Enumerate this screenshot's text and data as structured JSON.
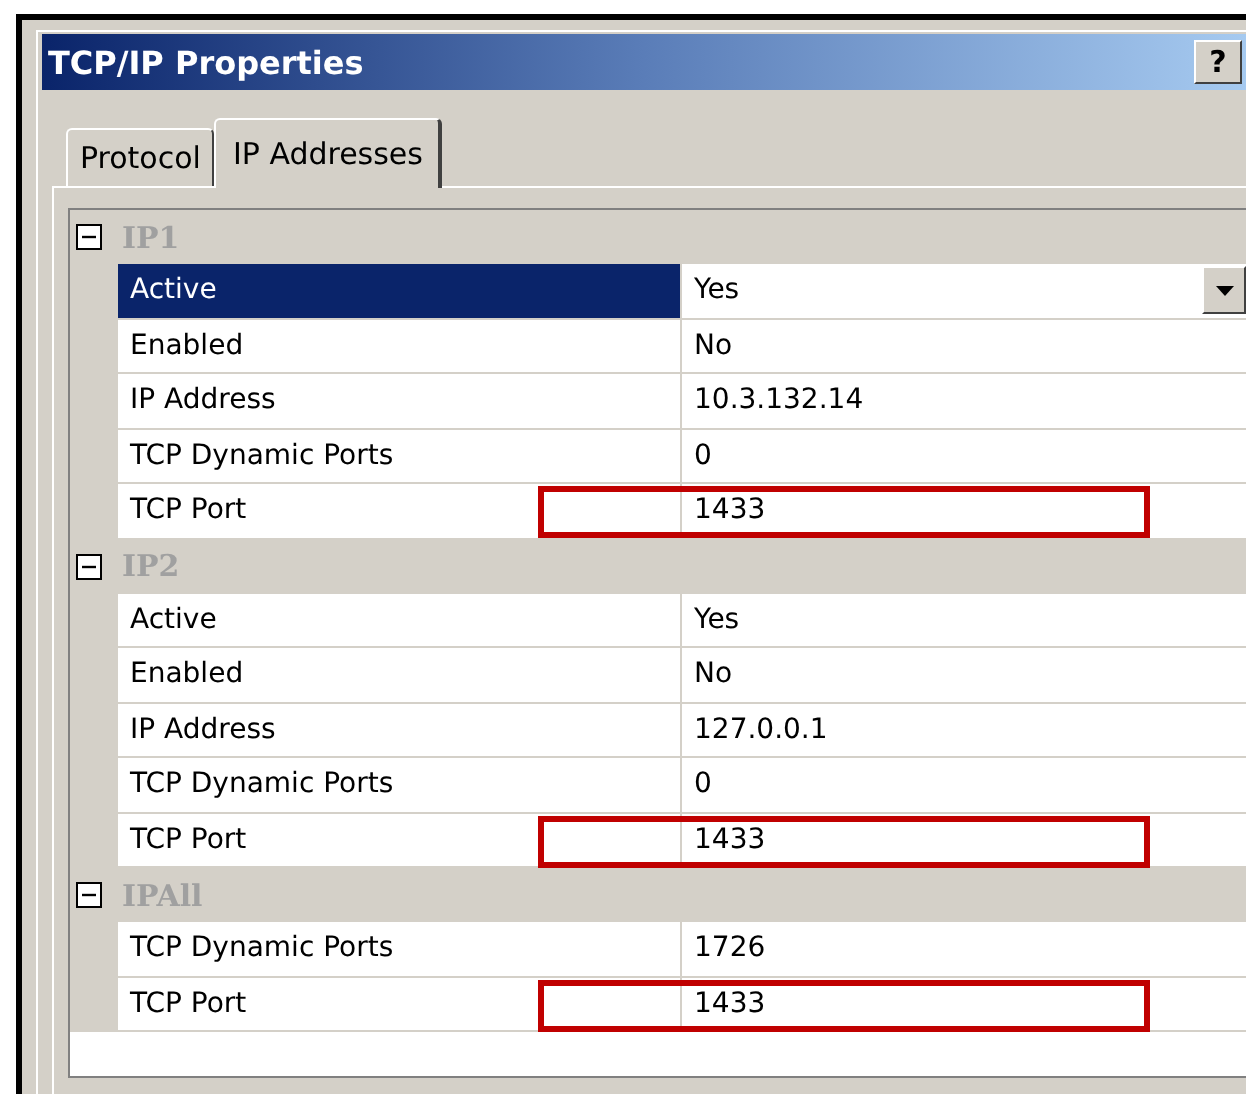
{
  "window": {
    "title": "TCP/IP Properties",
    "help_button": "?"
  },
  "tabs": [
    {
      "label": "Protocol",
      "selected": false
    },
    {
      "label": "IP Addresses",
      "selected": true
    }
  ],
  "groups": [
    {
      "name": "IP1",
      "expanded": true,
      "rows": [
        {
          "label": "Active",
          "value": "Yes",
          "selected": true,
          "highlighted": false
        },
        {
          "label": "Enabled",
          "value": "No",
          "selected": false,
          "highlighted": false
        },
        {
          "label": "IP Address",
          "value": "10.3.132.14",
          "selected": false,
          "highlighted": false
        },
        {
          "label": "TCP Dynamic Ports",
          "value": "0",
          "selected": false,
          "highlighted": false
        },
        {
          "label": "TCP Port",
          "value": "1433",
          "selected": false,
          "highlighted": true
        }
      ]
    },
    {
      "name": "IP2",
      "expanded": true,
      "rows": [
        {
          "label": "Active",
          "value": "Yes",
          "selected": false,
          "highlighted": false
        },
        {
          "label": "Enabled",
          "value": "No",
          "selected": false,
          "highlighted": false
        },
        {
          "label": "IP Address",
          "value": "127.0.0.1",
          "selected": false,
          "highlighted": false
        },
        {
          "label": "TCP Dynamic Ports",
          "value": "0",
          "selected": false,
          "highlighted": false
        },
        {
          "label": "TCP Port",
          "value": "1433",
          "selected": false,
          "highlighted": true
        }
      ]
    },
    {
      "name": "IPAll",
      "expanded": true,
      "rows": [
        {
          "label": "TCP Dynamic Ports",
          "value": "1726",
          "selected": false,
          "highlighted": false
        },
        {
          "label": "TCP Port",
          "value": "1433",
          "selected": false,
          "highlighted": true
        }
      ]
    }
  ]
}
